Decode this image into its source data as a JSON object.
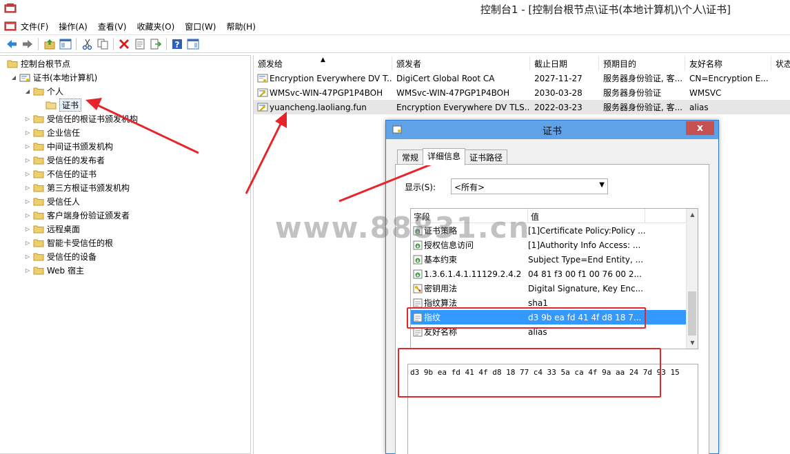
{
  "window": {
    "title": "控制台1 - [控制台根节点\\证书(本地计算机)\\个人\\证书]"
  },
  "menu": [
    "文件(F)",
    "操作(A)",
    "查看(V)",
    "收藏夹(O)",
    "窗口(W)",
    "帮助(H)"
  ],
  "tree": {
    "root": "控制台根节点",
    "store": "证书(本地计算机)",
    "personal": "个人",
    "certs": "证书",
    "items": [
      "受信任的根证书颁发机构",
      "企业信任",
      "中间证书颁发机构",
      "受信任的发布者",
      "不信任的证书",
      "第三方根证书颁发机构",
      "受信任人",
      "客户端身份验证颁发者",
      "远程桌面",
      "智能卡受信任的根",
      "受信任的设备",
      "Web 宿主"
    ]
  },
  "list": {
    "columns": [
      "颁发给",
      "颁发者",
      "截止日期",
      "预期目的",
      "友好名称",
      "状态"
    ],
    "rows": [
      [
        "Encryption Everywhere DV T...",
        "DigiCert Global Root CA",
        "2027-11-27",
        "服务器身份验证, 客...",
        "CN=Encryption E..."
      ],
      [
        "WMSvc-WIN-47PGP1P4BOH",
        "WMSvc-WIN-47PGP1P4BOH",
        "2030-03-28",
        "服务器身份验证",
        "WMSVC"
      ],
      [
        "yuancheng.laoliang.fun",
        "Encryption Everywhere DV TLS...",
        "2022-03-23",
        "服务器身份验证, 客...",
        "alias"
      ]
    ]
  },
  "dialog": {
    "title": "证书",
    "close": "x",
    "tabs": [
      "常规",
      "详细信息",
      "证书路径"
    ],
    "show_label": "显示(S):",
    "show_value": "<所有>",
    "field_headers": [
      "字段",
      "值"
    ],
    "fields": [
      [
        "证书策略",
        "[1]Certificate Policy:Policy ..."
      ],
      [
        "授权信息访问",
        "[1]Authority Info Access: ..."
      ],
      [
        "基本约束",
        "Subject Type=End Entity, ..."
      ],
      [
        "1.3.6.1.4.1.11129.2.4.2",
        "04 81 f3 00 f1 00 76 00 2..."
      ],
      [
        "密钥用法",
        "Digital Signature, Key Enc..."
      ],
      [
        "指纹算法",
        "sha1"
      ],
      [
        "指纹",
        "d3 9b ea fd 41 4f d8 18 7..."
      ],
      [
        "友好名称",
        "alias"
      ]
    ],
    "detail_value": "d3 9b ea fd 41 4f d8 18 77 c4 33 5a ca 4f 9a aa 24 7d 93 15"
  },
  "watermark": "www.88831.cn",
  "colors": {
    "annotation": "#e8242b",
    "selection": "#3399ff",
    "dialog_title": "#5fa3e6"
  }
}
